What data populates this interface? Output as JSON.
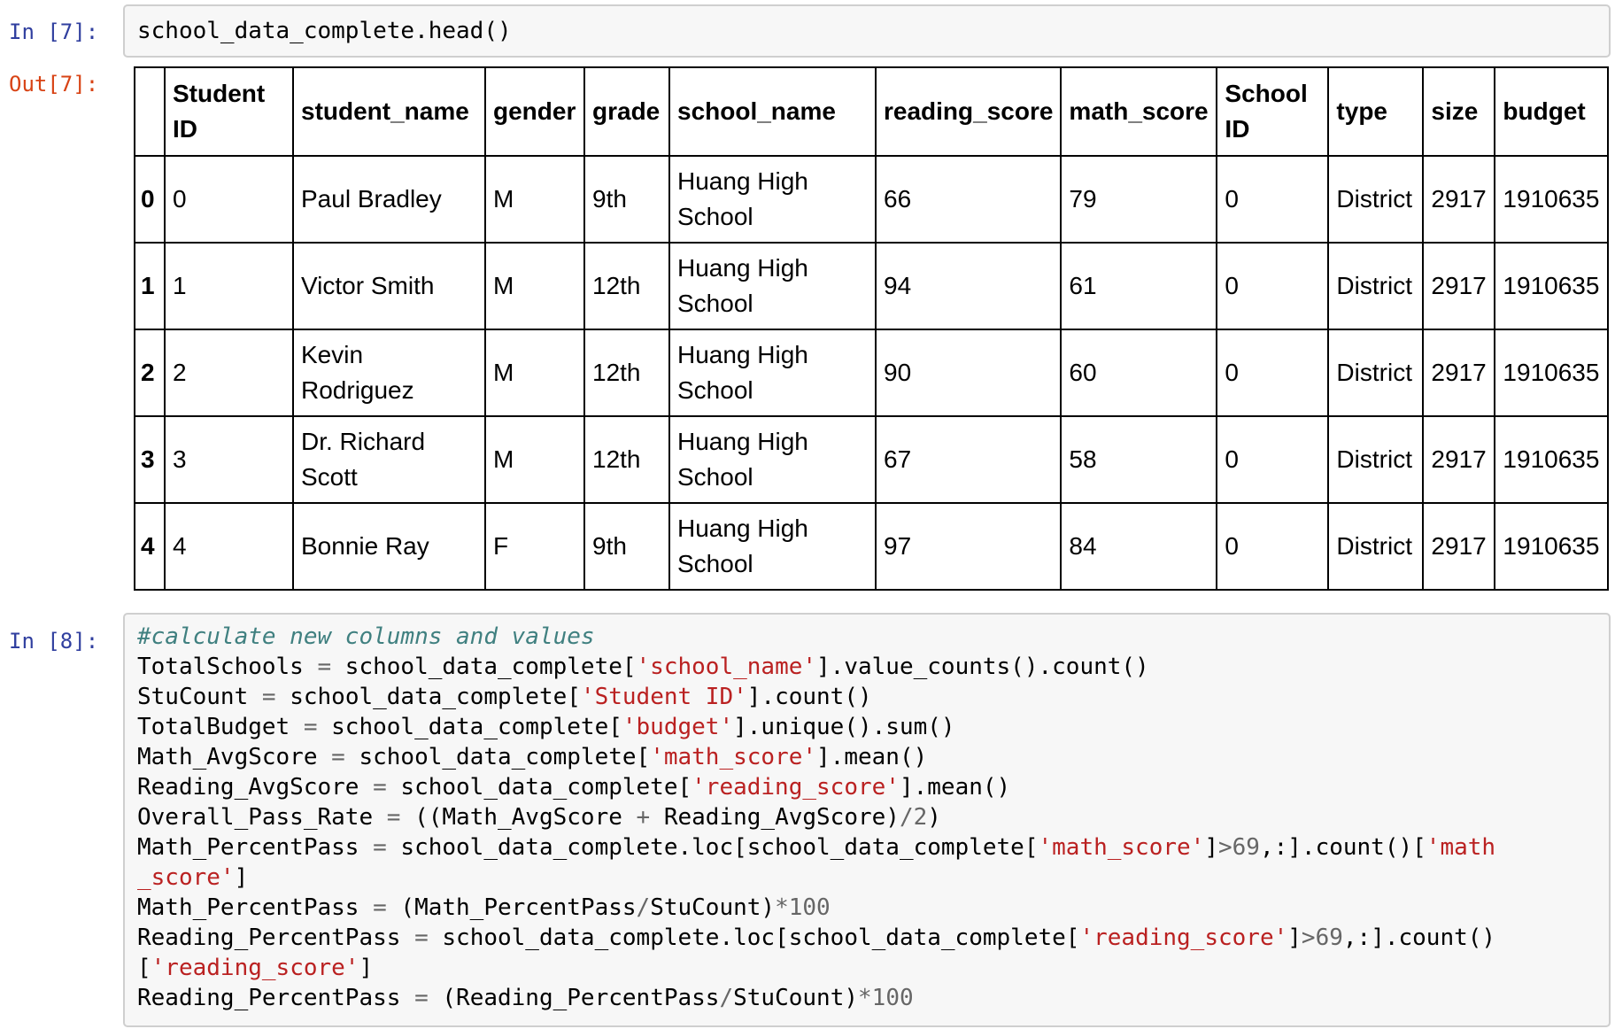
{
  "cell_7": {
    "in_prompt": "In [7]:",
    "out_prompt": "Out[7]:",
    "code": "school_data_complete.head()"
  },
  "dataframe": {
    "columns": [
      "",
      "Student ID",
      "student_name",
      "gender",
      "grade",
      "school_name",
      "reading_score",
      "math_score",
      "School ID",
      "type",
      "size",
      "budget"
    ],
    "rows": [
      {
        "index": "0",
        "cells": [
          "0",
          "Paul Bradley",
          "M",
          "9th",
          "Huang High School",
          "66",
          "79",
          "0",
          "District",
          "2917",
          "1910635"
        ]
      },
      {
        "index": "1",
        "cells": [
          "1",
          "Victor Smith",
          "M",
          "12th",
          "Huang High School",
          "94",
          "61",
          "0",
          "District",
          "2917",
          "1910635"
        ]
      },
      {
        "index": "2",
        "cells": [
          "2",
          "Kevin Rodriguez",
          "M",
          "12th",
          "Huang High School",
          "90",
          "60",
          "0",
          "District",
          "2917",
          "1910635"
        ]
      },
      {
        "index": "3",
        "cells": [
          "3",
          "Dr. Richard Scott",
          "M",
          "12th",
          "Huang High School",
          "67",
          "58",
          "0",
          "District",
          "2917",
          "1910635"
        ]
      },
      {
        "index": "4",
        "cells": [
          "4",
          "Bonnie Ray",
          "F",
          "9th",
          "Huang High School",
          "97",
          "84",
          "0",
          "District",
          "2917",
          "1910635"
        ]
      }
    ]
  },
  "cell_8": {
    "in_prompt": "In [8]:",
    "lines": [
      [
        [
          "comment",
          "#calculate new columns and values"
        ]
      ],
      [
        [
          "plain",
          "TotalSchools "
        ],
        [
          "op",
          "="
        ],
        [
          "plain",
          " school_data_complete["
        ],
        [
          "string",
          "'school_name'"
        ],
        [
          "plain",
          "].value_counts().count()"
        ]
      ],
      [
        [
          "plain",
          "StuCount "
        ],
        [
          "op",
          "="
        ],
        [
          "plain",
          " school_data_complete["
        ],
        [
          "string",
          "'Student ID'"
        ],
        [
          "plain",
          "].count()"
        ]
      ],
      [
        [
          "plain",
          "TotalBudget "
        ],
        [
          "op",
          "="
        ],
        [
          "plain",
          " school_data_complete["
        ],
        [
          "string",
          "'budget'"
        ],
        [
          "plain",
          "].unique().sum()"
        ]
      ],
      [
        [
          "plain",
          "Math_AvgScore "
        ],
        [
          "op",
          "="
        ],
        [
          "plain",
          " school_data_complete["
        ],
        [
          "string",
          "'math_score'"
        ],
        [
          "plain",
          "].mean()"
        ]
      ],
      [
        [
          "plain",
          "Reading_AvgScore "
        ],
        [
          "op",
          "="
        ],
        [
          "plain",
          " school_data_complete["
        ],
        [
          "string",
          "'reading_score'"
        ],
        [
          "plain",
          "].mean()"
        ]
      ],
      [
        [
          "plain",
          "Overall_Pass_Rate "
        ],
        [
          "op",
          "="
        ],
        [
          "plain",
          " ((Math_AvgScore "
        ],
        [
          "op",
          "+"
        ],
        [
          "plain",
          " Reading_AvgScore)"
        ],
        [
          "op",
          "/"
        ],
        [
          "op",
          "2"
        ],
        [
          "plain",
          ")"
        ]
      ],
      [
        [
          "plain",
          "Math_PercentPass "
        ],
        [
          "op",
          "="
        ],
        [
          "plain",
          " school_data_complete.loc[school_data_complete["
        ],
        [
          "string",
          "'math_score'"
        ],
        [
          "plain",
          "]"
        ],
        [
          "op",
          ">69"
        ],
        [
          "plain",
          ",:].count()["
        ],
        [
          "string",
          "'math"
        ]
      ],
      [
        [
          "string",
          "_score'"
        ],
        [
          "plain",
          "]"
        ]
      ],
      [
        [
          "plain",
          "Math_PercentPass "
        ],
        [
          "op",
          "="
        ],
        [
          "plain",
          " (Math_PercentPass"
        ],
        [
          "op",
          "/"
        ],
        [
          "plain",
          "StuCount)"
        ],
        [
          "op",
          "*100"
        ]
      ],
      [
        [
          "plain",
          "Reading_PercentPass "
        ],
        [
          "op",
          "="
        ],
        [
          "plain",
          " school_data_complete.loc[school_data_complete["
        ],
        [
          "string",
          "'reading_score'"
        ],
        [
          "plain",
          "]"
        ],
        [
          "op",
          ">69"
        ],
        [
          "plain",
          ",:].count()"
        ]
      ],
      [
        [
          "plain",
          "["
        ],
        [
          "string",
          "'reading_score'"
        ],
        [
          "plain",
          "]"
        ]
      ],
      [
        [
          "plain",
          "Reading_PercentPass "
        ],
        [
          "op",
          "="
        ],
        [
          "plain",
          " (Reading_PercentPass"
        ],
        [
          "op",
          "/"
        ],
        [
          "plain",
          "StuCount)"
        ],
        [
          "op",
          "*100"
        ]
      ]
    ]
  }
}
